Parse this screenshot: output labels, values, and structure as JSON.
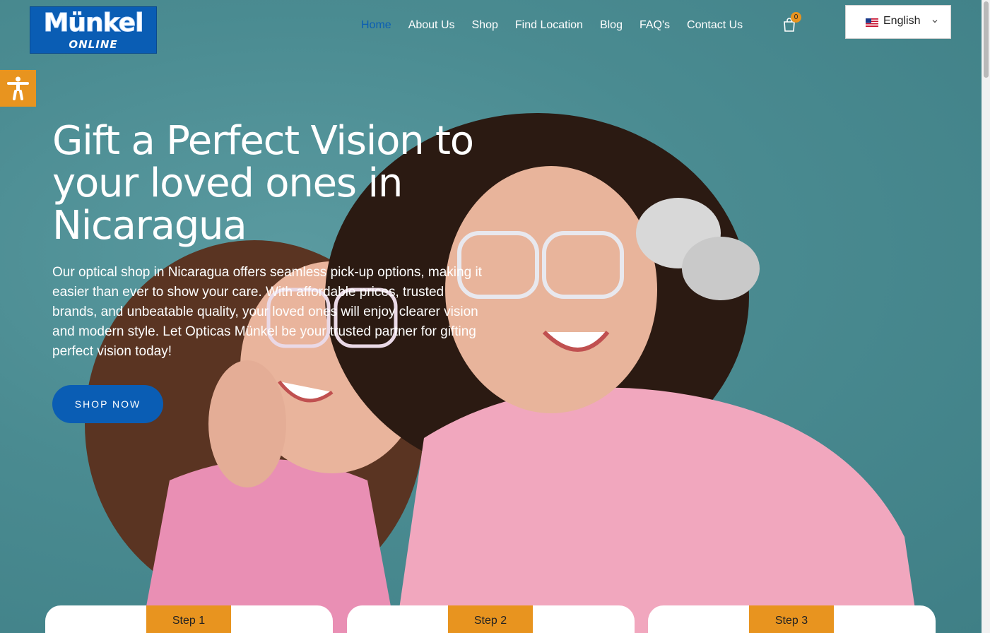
{
  "header": {
    "logo": {
      "main": "Münkel",
      "sub": "ONLINE"
    },
    "nav": [
      "Home",
      "About Us",
      "Shop",
      "Find Location",
      "Blog",
      "FAQ's",
      "Contact Us"
    ],
    "active_nav": "Home",
    "cart_count": "0",
    "cart_icon": "shopping-bag-icon",
    "language": {
      "label": "English",
      "flag_icon": "us-flag-icon",
      "chevron_icon": "chevron-down-icon"
    }
  },
  "accessibility": {
    "icon": "accessibility-icon"
  },
  "hero": {
    "title": "Gift a Perfect Vision to your loved ones in Nicaragua",
    "body": "Our optical shop in Nicaragua offers seamless pick-up options, making it easier than ever to show your care. With affordable prices, trusted brands, and unbeatable quality, your loved ones will enjoy clearer vision and modern style. Let Opticas Münkel be your trusted partner for gifting perfect vision today!",
    "cta": "SHOP NOW"
  },
  "steps": [
    {
      "label": "Step 1"
    },
    {
      "label": "Step 2"
    },
    {
      "label": "Step 3"
    }
  ],
  "colors": {
    "brand_blue": "#0a5db4",
    "accent_orange": "#e8941f",
    "background_teal": "#4e8f95",
    "nav_text": "#ffffff"
  }
}
